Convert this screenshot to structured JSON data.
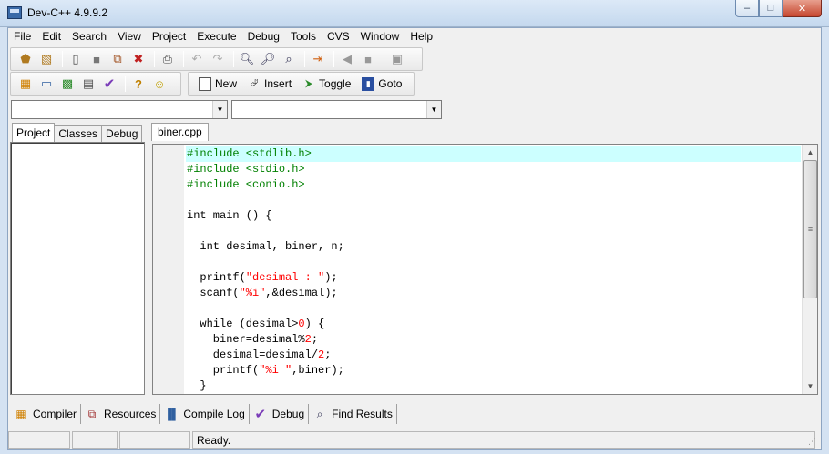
{
  "window": {
    "title": "Dev-C++ 4.9.9.2"
  },
  "menu": [
    "File",
    "Edit",
    "Search",
    "View",
    "Project",
    "Execute",
    "Debug",
    "Tools",
    "CVS",
    "Window",
    "Help"
  ],
  "toolbar2": {
    "new_label": "New",
    "insert_label": "Insert",
    "toggle_label": "Toggle",
    "goto_label": "Goto"
  },
  "combos": {
    "class_value": "",
    "member_value": ""
  },
  "left_tabs": [
    "Project",
    "Classes",
    "Debug"
  ],
  "editor": {
    "tab_label": "biner.cpp",
    "lines": [
      "#include <stdlib.h>",
      "#include <stdio.h>",
      "#include <conio.h>",
      "",
      "int main () {",
      "",
      "  int desimal, biner, n;",
      "",
      "  printf(\"desimal : \");",
      "  scanf(\"%i\",&desimal);",
      "",
      "  while (desimal>0) {",
      "    biner=desimal%2;",
      "    desimal=desimal/2;",
      "    printf(\"%i \",biner);",
      "  }"
    ]
  },
  "bottom_tabs": [
    "Compiler",
    "Resources",
    "Compile Log",
    "Debug",
    "Find Results"
  ],
  "status": {
    "message": "Ready."
  }
}
